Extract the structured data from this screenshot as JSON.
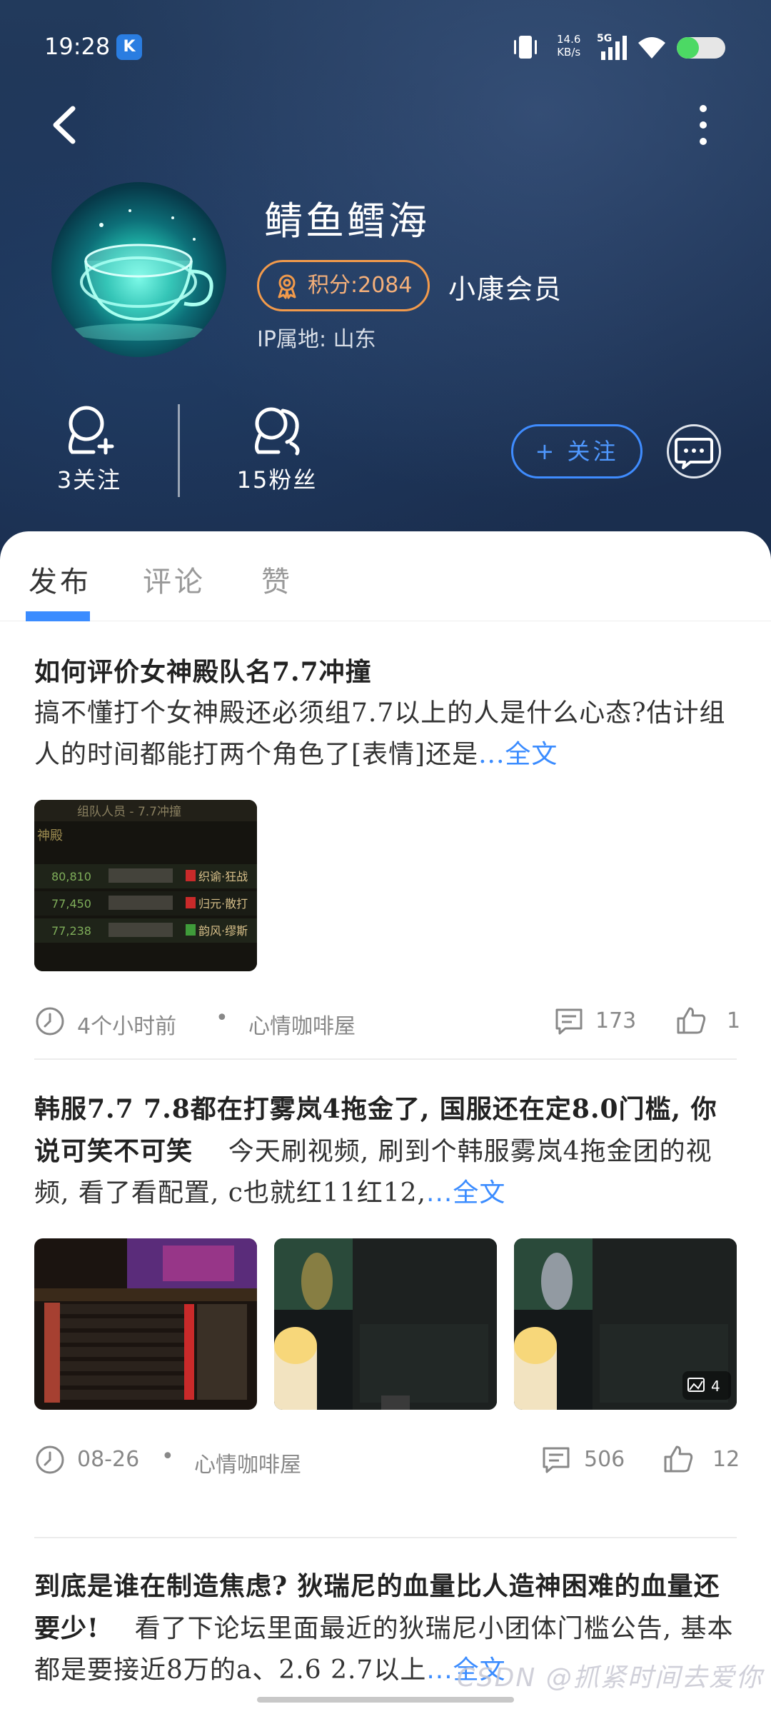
{
  "status_bar": {
    "time": "19:28",
    "app_badge": "K",
    "net_speed_value": "14.6",
    "net_speed_unit": "KB/s",
    "network": "5G",
    "battery_level": 0.45
  },
  "profile": {
    "username": "鲭鱼鳕海",
    "points_label": "积分:2084",
    "member_level": "小康会员",
    "ip_location": "IP属地: 山东",
    "following_label": "3关注",
    "fans_label": "15粉丝",
    "follow_button": "+ 关注"
  },
  "tabs": [
    {
      "label": "发布",
      "active": true
    },
    {
      "label": "评论",
      "active": false
    },
    {
      "label": "赞",
      "active": false
    }
  ],
  "posts": [
    {
      "title": "如何评价女神殿队名7.7冲撞",
      "body": "搞不懂打个女神殿还必须组7.7以上的人是什么心态?估计组人的时间都能打两个角色了[表情]还是",
      "read_more": "...全文",
      "time": "4个小时前",
      "dot": "•",
      "category": "心情咖啡屋",
      "comments": "173",
      "likes": "1"
    },
    {
      "title": "韩服7.7 7.8都在打雾岚4拖金了, 国服还在定8.0门槛, 你说可笑不可笑",
      "body": "今天刷视频, 刷到个韩服雾岚4拖金团的视频, 看了看配置, c也就红11红12,",
      "read_more": "...全文",
      "time": "08-26",
      "dot": "•",
      "category": "心情咖啡屋",
      "comments": "506",
      "likes": "12",
      "image_count": "4"
    },
    {
      "title": "到底是谁在制造焦虑? 狄瑞尼的血量比人造神困难的血量还要少!",
      "body": "看了下论坛里面最近的狄瑞尼小团体门槛公告, 基本都是要接近8万的a、2.6 2.7以上",
      "read_more": "...全文"
    }
  ],
  "thumb1": {
    "header": "组队人员 - 7.7冲撞",
    "row_label": "神殿",
    "rows": [
      "80,810",
      "77,450",
      "77,238"
    ],
    "roles": [
      "织谕·狂战",
      "归元·散打",
      "韵风·缪斯"
    ]
  },
  "watermark": "CSDN @抓紧时间去爱你",
  "colors": {
    "accent": "#3b8cff",
    "points": "#f29a4b"
  }
}
